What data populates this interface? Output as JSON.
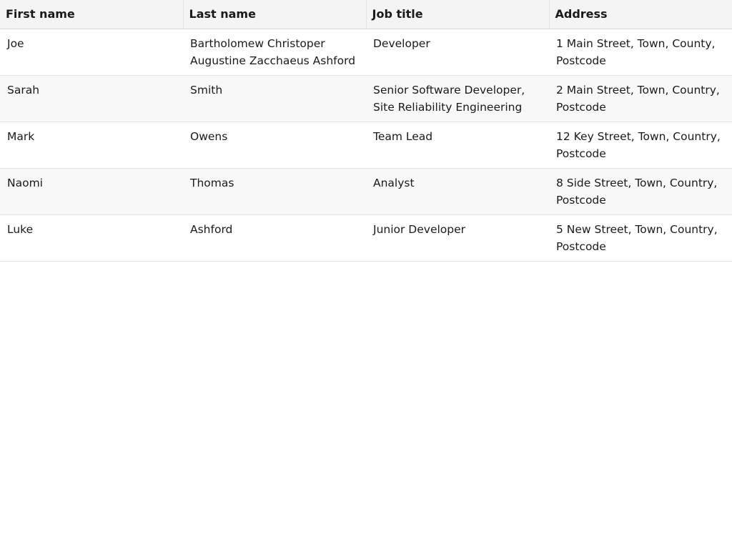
{
  "table": {
    "headers": [
      "First name",
      "Last name",
      "Job title",
      "Address"
    ],
    "rows": [
      [
        "Joe",
        "Bartholomew Christoper Augustine Zacchaeus Ashford",
        "Developer",
        "1 Main Street, Town, County, Postcode"
      ],
      [
        "Sarah",
        "Smith",
        "Senior Software Developer, Site Reliability Engineering",
        "2 Main Street, Town, Country, Postcode"
      ],
      [
        "Mark",
        "Owens",
        "Team Lead",
        "12 Key Street, Town, Country, Postcode"
      ],
      [
        "Naomi",
        "Thomas",
        "Analyst",
        "8 Side Street, Town, Country, Postcode"
      ],
      [
        "Luke",
        "Ashford",
        "Junior Developer",
        "5 New Street, Town, Country, Postcode"
      ]
    ]
  }
}
